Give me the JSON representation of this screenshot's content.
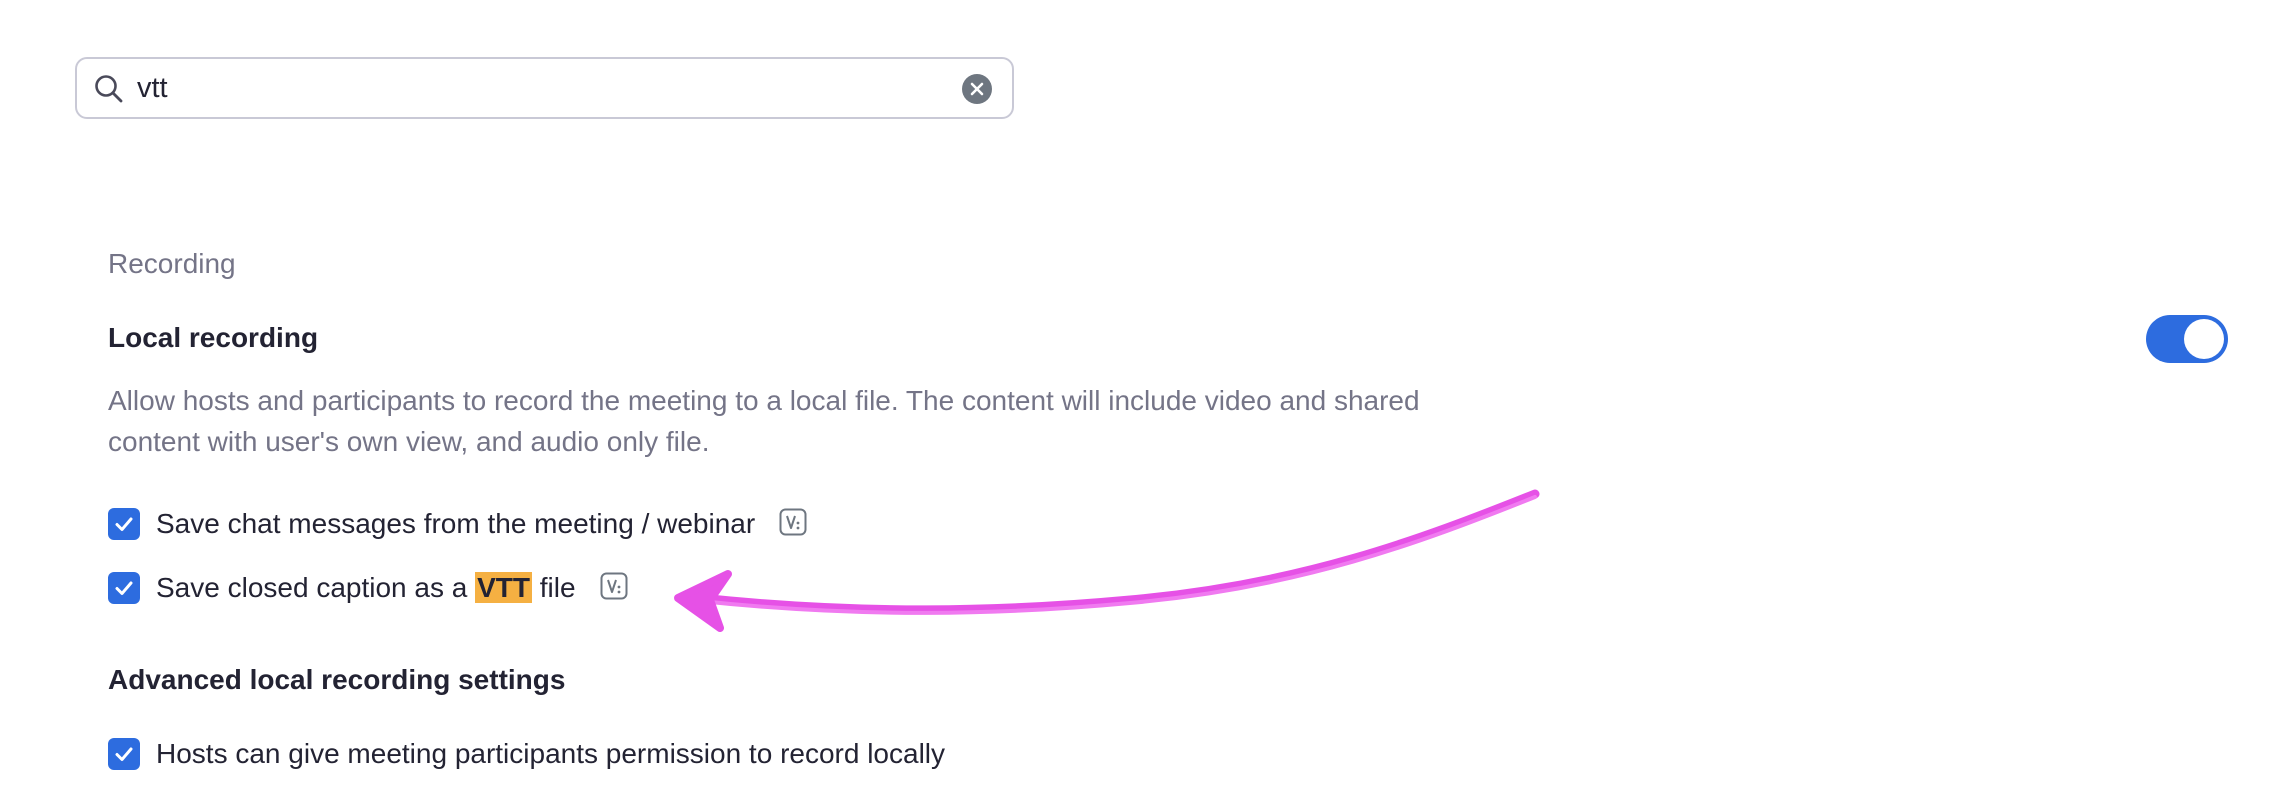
{
  "search": {
    "value": "vtt",
    "icon": "search-icon",
    "clear_icon": "close-icon"
  },
  "section": {
    "title": "Recording"
  },
  "local_recording": {
    "title": "Local recording",
    "enabled": true,
    "description": "Allow hosts and participants to record the meeting to a local file. The content will include video and shared content with user's own view, and audio only file.",
    "options": [
      {
        "label": "Save chat messages from the meeting / webinar",
        "checked": true,
        "lock_icon": "lock-icon"
      },
      {
        "label_before": "Save closed caption as a",
        "label_highlight": "VTT",
        "label_after": "file",
        "checked": true,
        "lock_icon": "lock-icon"
      }
    ]
  },
  "advanced": {
    "title": "Advanced local recording settings",
    "options": [
      {
        "label": "Hosts can give meeting participants permission to record locally",
        "checked": true
      }
    ]
  },
  "colors": {
    "accent": "#2d6cdf",
    "highlight": "#f5b042",
    "annotation": "#e651e6"
  }
}
